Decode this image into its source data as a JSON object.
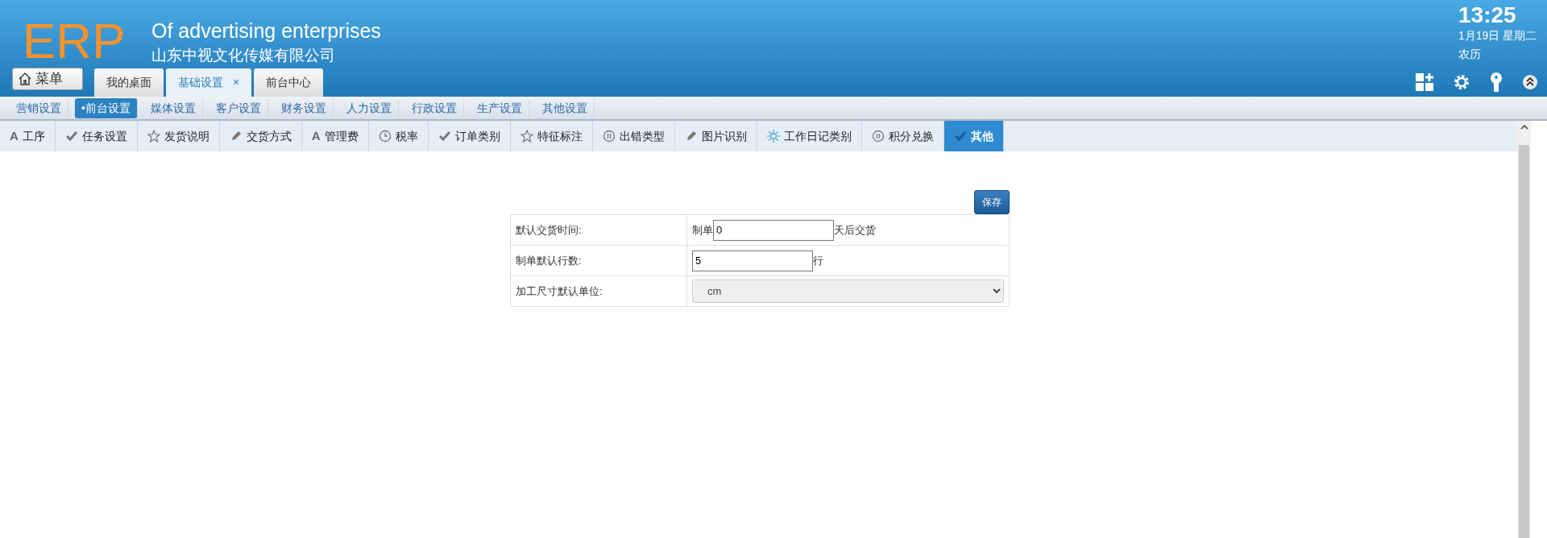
{
  "header": {
    "logo": "ERP",
    "title": "Of advertising enterprises",
    "company": "山东中视文化传媒有限公司",
    "menu_button": "菜单",
    "clock": {
      "time": "13:25",
      "date": "1月19日 星期二",
      "lunar": "农历"
    }
  },
  "tabs": [
    {
      "label": "我的桌面",
      "selected": false
    },
    {
      "label": "基础设置",
      "selected": true,
      "close": "×"
    },
    {
      "label": "前台中心",
      "selected": false
    }
  ],
  "subnav": [
    {
      "label": "营销设置",
      "selected": false
    },
    {
      "label": "•前台设置",
      "selected": true
    },
    {
      "label": "媒体设置",
      "selected": false
    },
    {
      "label": "客户设置",
      "selected": false
    },
    {
      "label": "财务设置",
      "selected": false
    },
    {
      "label": "人力设置",
      "selected": false
    },
    {
      "label": "行政设置",
      "selected": false
    },
    {
      "label": "生产设置",
      "selected": false
    },
    {
      "label": "其他设置",
      "selected": false
    }
  ],
  "toolbar": [
    {
      "label": "工序",
      "kind": "letter",
      "glyph": "A",
      "selected": false
    },
    {
      "label": "任务设置",
      "kind": "check",
      "selected": false
    },
    {
      "label": "发货说明",
      "kind": "star",
      "selected": false
    },
    {
      "label": "交货方式",
      "kind": "pencil",
      "selected": false
    },
    {
      "label": "管理费",
      "kind": "letter",
      "glyph": "A",
      "selected": false
    },
    {
      "label": "税率",
      "kind": "clock",
      "selected": false
    },
    {
      "label": "订单类别",
      "kind": "check",
      "selected": false
    },
    {
      "label": "特征标注",
      "kind": "star",
      "selected": false
    },
    {
      "label": "出错类型",
      "kind": "pause",
      "selected": false
    },
    {
      "label": "图片识别",
      "kind": "pencil",
      "selected": false
    },
    {
      "label": "工作日记类别",
      "kind": "sun",
      "selected": false
    },
    {
      "label": "积分兑换",
      "kind": "pause",
      "selected": false
    },
    {
      "label": "其他",
      "kind": "check",
      "selected": true
    }
  ],
  "form": {
    "save_button": "保存",
    "rows": [
      {
        "label": "默认交货时间:",
        "kind": "input",
        "prefix": "制单",
        "value": "0",
        "suffix": "天后交货"
      },
      {
        "label": "制单默认行数:",
        "kind": "input",
        "value": "5",
        "suffix": "行"
      },
      {
        "label": "加工尺寸默认单位:",
        "kind": "select",
        "value": "cm"
      }
    ]
  }
}
